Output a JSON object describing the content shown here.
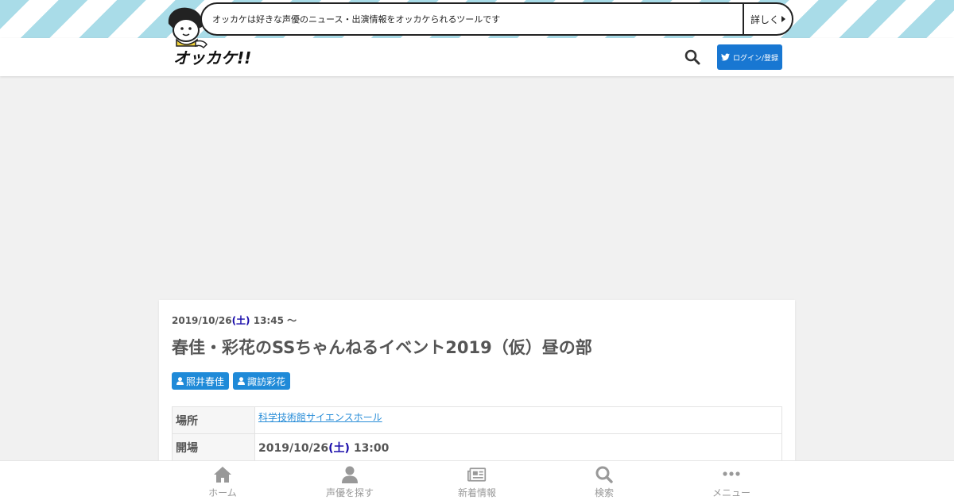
{
  "banner": {
    "tagline": "オッカケは好きな声優のニュース・出演情報をオッカケられるツールです",
    "more_label": "詳しく"
  },
  "header": {
    "logo_text": "オッカケ!!",
    "login_label": "ログイン/登録"
  },
  "event": {
    "date": "2019/10/26",
    "day_of_week": "(土)",
    "start_time": " 13:45 〜",
    "title": "春佳・彩花のSSちゃんねるイベント2019（仮）昼の部",
    "cast": [
      {
        "name": "照井春佳"
      },
      {
        "name": "諏訪彩花"
      }
    ],
    "details": {
      "venue_label": "場所",
      "venue_value": "科学技術館サイエンスホール",
      "open_label": "開場",
      "open_date": "2019/10/26",
      "open_dow": "(土)",
      "open_time": " 13:00"
    }
  },
  "bottom_nav": {
    "items": [
      {
        "label": "ホーム",
        "icon": "home-icon"
      },
      {
        "label": "声優を探す",
        "icon": "user-icon"
      },
      {
        "label": "新着情報",
        "icon": "newspaper-icon"
      },
      {
        "label": "検索",
        "icon": "search-icon"
      },
      {
        "label": "メニュー",
        "icon": "ellipsis-icon"
      }
    ]
  },
  "colors": {
    "stripe": "#a9dce8",
    "brand_blue": "#1877d2",
    "tag_blue": "#1f8ad8",
    "link": "#2a8ed8",
    "day_of_week": "#1a0dab"
  }
}
